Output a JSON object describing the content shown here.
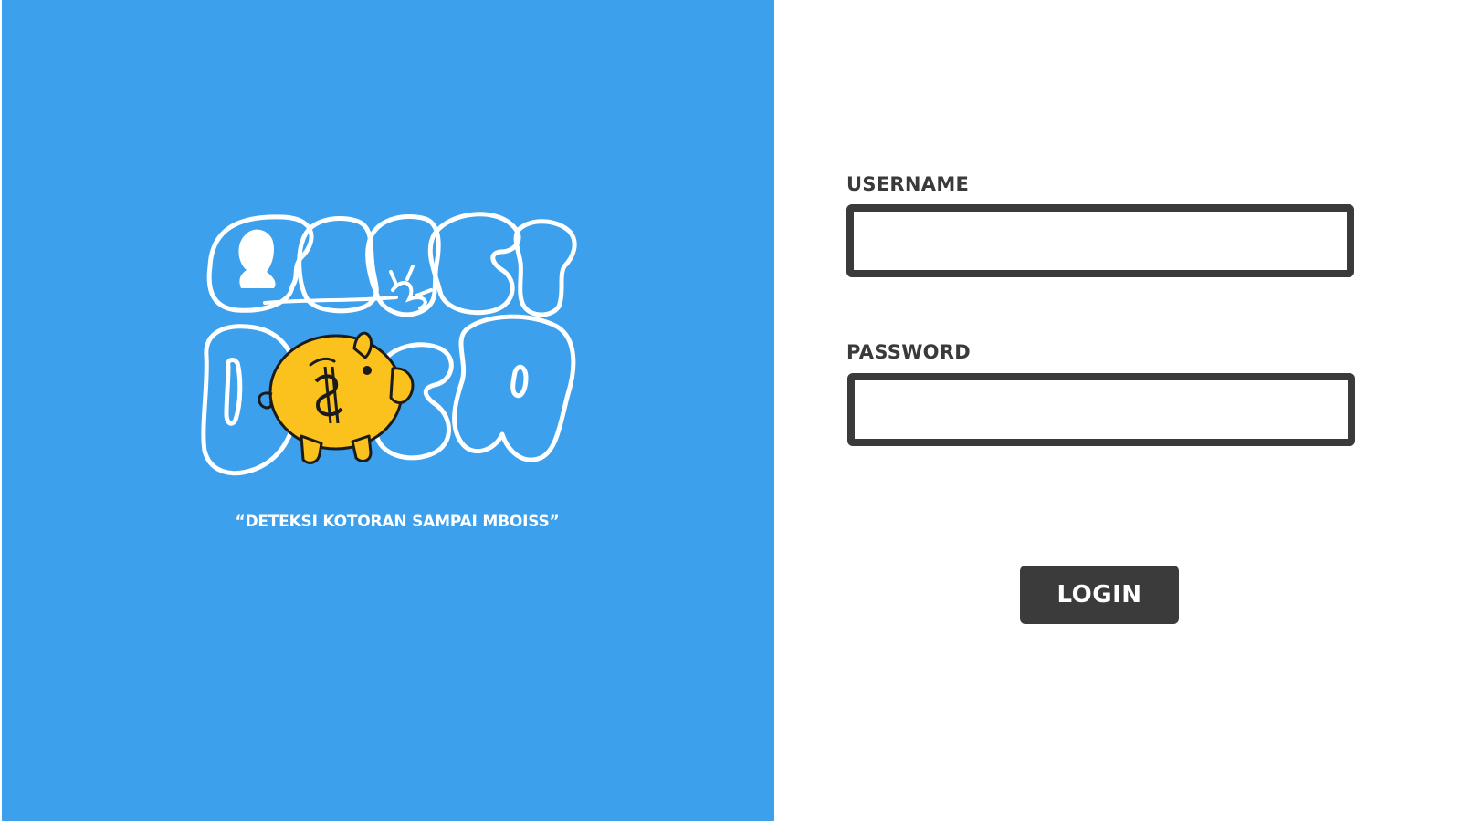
{
  "branding": {
    "logo_name": "piggy-bank-logo",
    "tagline": "“DETEKSI KOTORAN SAMPAI MBOISS”",
    "panel_color": "#3da0ec"
  },
  "login_form": {
    "username_label": "USERNAME",
    "username_value": "",
    "password_label": "PASSWORD",
    "password_value": "",
    "login_label": "LOGIN",
    "button_color": "#3b3b3b",
    "border_color": "#3a3a3a"
  }
}
